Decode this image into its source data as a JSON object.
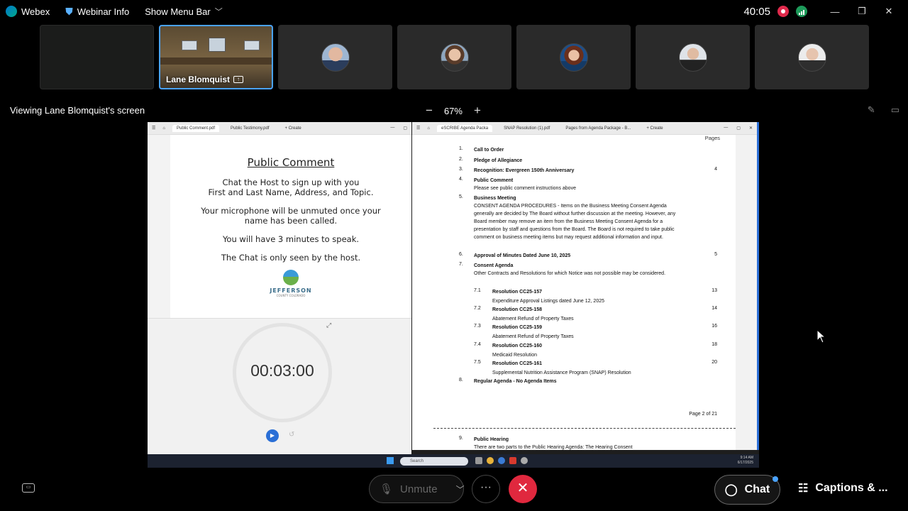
{
  "topbar": {
    "app_name": "Webex",
    "webinar_info": "Webinar Info",
    "menu_bar": "Show Menu Bar",
    "timer": "40:05",
    "window_controls": [
      "—",
      "❐",
      "✕"
    ]
  },
  "participants": [
    {
      "name": "",
      "type": "empty"
    },
    {
      "name": "Lane Blomquist",
      "type": "room",
      "sharing": true
    },
    {
      "name": "",
      "type": "avatar"
    },
    {
      "name": "",
      "type": "avatar"
    },
    {
      "name": "",
      "type": "avatar"
    },
    {
      "name": "",
      "type": "avatar"
    },
    {
      "name": "",
      "type": "avatar"
    }
  ],
  "share": {
    "viewing_label": "Viewing Lane Blomquist's screen",
    "zoom_level": "67%",
    "zoom_minus": "−",
    "zoom_plus": "+"
  },
  "left_window": {
    "tabs": [
      "Public Comment.pdf",
      "Public Testimony.pdf",
      "+ Create"
    ],
    "title": "Public Comment",
    "para1a": "Chat the Host to sign up with you",
    "para1b": "First and Last Name, Address, and Topic.",
    "para2a": "Your microphone will be unmuted once your",
    "para2b": "name has been called.",
    "para3": "You will have 3 minutes to speak.",
    "para4": "The Chat is only seen by the host.",
    "logo_name": "JEFFERSON",
    "logo_sub": "COUNTY COLORADO",
    "timer": "00:03:00"
  },
  "right_window": {
    "tabs": [
      "eSCRIBE Agenda Packa",
      "SNAP Resolution (1).pdf",
      "Pages from Agenda Package - B...",
      "+ Create"
    ],
    "pages_header": "Pages",
    "agenda": [
      {
        "num": "1.",
        "title": "Call to Order",
        "page": ""
      },
      {
        "num": "2.",
        "title": "Pledge of Allegiance",
        "page": ""
      },
      {
        "num": "3.",
        "title": "Recognition:  Evergreen 150th Anniversary",
        "page": "4"
      },
      {
        "num": "4.",
        "title": "Public Comment",
        "desc": "Please see public comment instructions above",
        "page": ""
      },
      {
        "num": "5.",
        "title": "Business Meeting",
        "desc": "CONSENT AGENDA PROCEDURES - Items on the Business Meeting Consent Agenda generally are decided by The Board without further discussion at the meeting.  However, any Board member may remove an item from the Business Meeting Consent Agenda for a presentation by staff and questions from the Board.  The Board is not required to take public comment on business meeting items but may request additional information and input.",
        "page": ""
      },
      {
        "num": "6.",
        "title": "Approval of Minutes Dated June 10, 2025",
        "page": "5"
      },
      {
        "num": "7.",
        "title": "Consent Agenda",
        "desc": "Other Contracts and Resolutions for which Notice was not possible may be considered.",
        "page": ""
      }
    ],
    "sub_items": [
      {
        "num": "7.1",
        "title": "Resolution CC25-157",
        "desc": "Expenditure Approval Listings dated June 12, 2025",
        "page": "13"
      },
      {
        "num": "7.2",
        "title": "Resolution CC25-158",
        "desc": "Abatement Refund of Property Taxes",
        "page": "14"
      },
      {
        "num": "7.3",
        "title": "Resolution CC25-159",
        "desc": "Abatement Refund of Property Taxes",
        "page": "16"
      },
      {
        "num": "7.4",
        "title": "Resolution CC25-160",
        "desc": "Medicaid Resolution",
        "page": "18"
      },
      {
        "num": "7.5",
        "title": "Resolution CC25-161",
        "desc": "Supplemental Nutrition Assistance Program (SNAP) Resolution",
        "page": "20"
      }
    ],
    "item8": {
      "num": "8.",
      "title": "Regular Agenda - No Agenda Items"
    },
    "page_of": "Page 2 of 21",
    "item9": {
      "num": "9.",
      "title": "Public Hearing",
      "desc": "There are two parts to the Public Hearing Agenda: The Hearing Consent"
    }
  },
  "taskbar": {
    "search": "Search",
    "time": "9:14 AM",
    "date": "6/17/2025"
  },
  "controls": {
    "unmute": "Unmute",
    "more": "···",
    "leave": "✕",
    "chat": "Chat",
    "captions": "Captions & ..."
  }
}
